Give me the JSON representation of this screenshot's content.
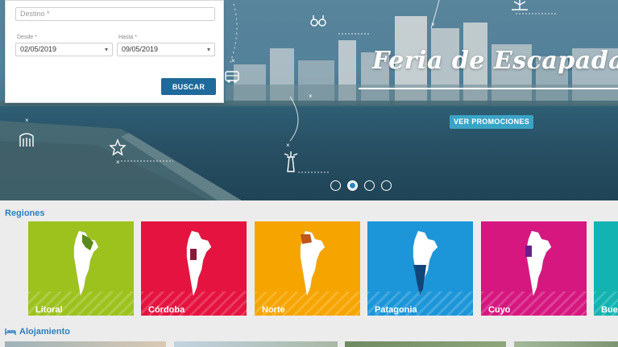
{
  "hero": {
    "title": "Feria de Escapadas",
    "promo_button": "VER PROMOCIONES",
    "slides": [
      false,
      true,
      false,
      false
    ]
  },
  "search": {
    "destination_placeholder": "Destino *",
    "from_label": "Desde *",
    "from_value": "02/05/2019",
    "to_label": "Hasta *",
    "to_value": "09/05/2019",
    "search_button": "BUSCAR"
  },
  "regions": {
    "title": "Regiones",
    "items": [
      {
        "name": "Litoral",
        "color": "#9dc21e",
        "highlight": "#5a8a1a"
      },
      {
        "name": "Córdoba",
        "color": "#e5133f",
        "highlight": "#8a1a3a"
      },
      {
        "name": "Norte",
        "color": "#f6a400",
        "highlight": "#c0561a"
      },
      {
        "name": "Patagonia",
        "color": "#1c96d8",
        "highlight": "#12467a"
      },
      {
        "name": "Cuyo",
        "color": "#d6177f",
        "highlight": "#6a1e86"
      },
      {
        "name": "Bue",
        "color": "#12b3b0",
        "highlight": "#0d7f7d"
      }
    ]
  },
  "lodging": {
    "title": "Alojamiento",
    "icon": "bed-icon"
  }
}
